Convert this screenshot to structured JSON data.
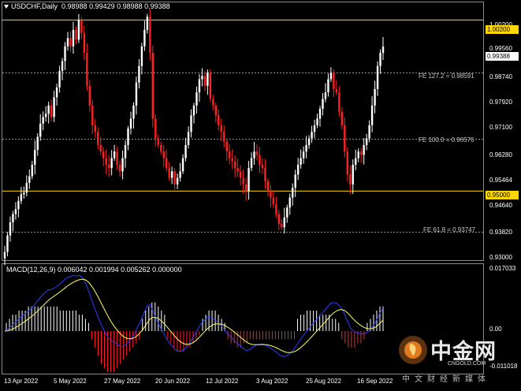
{
  "header": {
    "symbol_timeframe": "USDCHF,Daily",
    "ohlc": "0.98988 0.99429 0.98988 0.99388"
  },
  "indicator": {
    "label": "MACD(12,26,9) 0.006042 0.001994 0.005262 0.000000"
  },
  "price_axis": {
    "ticks": [
      "1.00200",
      "0.99560",
      "0.98740",
      "0.97920",
      "0.97100",
      "0.96280",
      "0.95464",
      "0.94640",
      "0.93820",
      "0.93000"
    ],
    "level_labels": [
      "1.00200",
      "0.95000"
    ],
    "current_price": "0.99388"
  },
  "macd_axis": {
    "ticks": [
      "0.017033",
      "0.00",
      "-0.011018"
    ]
  },
  "time_axis": {
    "labels": [
      "13 Apr 2022",
      "5 May 2022",
      "27 May 2022",
      "20 Jun 2022",
      "12 Jul 2022",
      "3 Aug 2022",
      "25 Aug 2022",
      "16 Sep 2022"
    ]
  },
  "fibonacci": [
    {
      "label": "FE 127.2 = 0.98591",
      "price": 0.98591
    },
    {
      "label": "FE 100.0 = 0.96576",
      "price": 0.96576
    },
    {
      "label": "FE 61.8 = 0.93747",
      "price": 0.93747
    }
  ],
  "levels": [
    1.002,
    0.95
  ],
  "colors": {
    "background": "#000000",
    "bull": "#ffffff",
    "bear": "#ff2020",
    "level": "#ffd700",
    "fib": "#9a9a9a",
    "macd_signal": "#ffff66",
    "macd_line": "#2a3cff"
  },
  "watermark": {
    "brand": "中金网",
    "url": "CNGOLD.COM",
    "tagline": "中文财经新媒体"
  },
  "chart_data": {
    "type": "candlestick",
    "series_interval": "daily",
    "price_range": [
      0.93,
      1.006
    ],
    "macd_range": [
      -0.011018,
      0.017033
    ],
    "close": [
      0.9315,
      0.9365,
      0.9405,
      0.943,
      0.9445,
      0.947,
      0.949,
      0.9495,
      0.9525,
      0.9545,
      0.958,
      0.9625,
      0.9665,
      0.9705,
      0.9725,
      0.9735,
      0.976,
      0.9725,
      0.9785,
      0.9815,
      0.9865,
      0.9895,
      0.994,
      0.9965,
      0.994,
      0.999,
      0.996,
      1.002,
      0.998,
      0.992,
      0.982,
      0.976,
      0.97,
      0.968,
      0.964,
      0.962,
      0.96,
      0.958,
      0.957,
      0.96,
      0.962,
      0.958,
      0.956,
      0.96,
      0.964,
      0.969,
      0.972,
      0.976,
      0.983,
      0.988,
      0.994,
      0.999,
      1.003,
      0.992,
      0.972,
      0.966,
      0.964,
      0.962,
      0.96,
      0.957,
      0.954,
      0.956,
      0.952,
      0.954,
      0.956,
      0.96,
      0.964,
      0.968,
      0.973,
      0.976,
      0.98,
      0.984,
      0.985,
      0.982,
      0.986,
      0.978,
      0.976,
      0.973,
      0.97,
      0.968,
      0.965,
      0.962,
      0.96,
      0.959,
      0.957,
      0.956,
      0.954,
      0.952,
      0.95,
      0.957,
      0.96,
      0.962,
      0.961,
      0.958,
      0.957,
      0.953,
      0.95,
      0.948,
      0.946,
      0.943,
      0.94,
      0.939,
      0.942,
      0.945,
      0.948,
      0.951,
      0.955,
      0.958,
      0.96,
      0.962,
      0.964,
      0.966,
      0.968,
      0.97,
      0.972,
      0.975,
      0.978,
      0.98,
      0.984,
      0.986,
      0.981,
      0.98,
      0.974,
      0.97,
      0.962,
      0.955,
      0.952,
      0.958,
      0.96,
      0.962,
      0.961,
      0.964,
      0.966,
      0.97,
      0.976,
      0.981,
      0.988,
      0.992,
      0.9939
    ],
    "macd_histogram": [
      0.002,
      0.003,
      0.004,
      0.004,
      0.005,
      0.005,
      0.005,
      0.006,
      0.006,
      0.006,
      0.006,
      0.006,
      0.006,
      0.006,
      0.006,
      0.006,
      0.006,
      0.005,
      0.005,
      0.005,
      0.005,
      0.005,
      0.005,
      0.004,
      0.004,
      0.003,
      0.002,
      -0.002,
      -0.004,
      -0.006,
      -0.008,
      -0.009,
      -0.01,
      -0.01,
      -0.01,
      -0.009,
      -0.008,
      -0.007,
      -0.006,
      -0.005,
      -0.004,
      -0.003,
      -0.002,
      0.003,
      0.005,
      0.006,
      0.007,
      0.007,
      0.006,
      0.005,
      0.004,
      -0.002,
      -0.003,
      -0.004,
      -0.005,
      -0.005,
      -0.005,
      -0.004,
      -0.004,
      -0.003,
      -0.002,
      -0.001,
      0.003,
      0.004,
      0.005,
      0.005,
      0.005,
      0.004,
      0.003,
      0.002,
      -0.002,
      -0.003,
      -0.003,
      -0.004,
      -0.004,
      -0.003,
      -0.003,
      -0.002,
      -0.002,
      -0.002,
      -0.002,
      -0.002,
      -0.002,
      -0.002,
      -0.002,
      -0.002,
      -0.002,
      -0.002,
      -0.002,
      -0.002,
      -0.002,
      -0.002,
      0.003,
      0.004,
      0.004,
      0.005,
      0.005,
      0.005,
      0.005,
      0.004,
      0.004,
      0.004,
      0.004,
      0.003,
      0.003,
      0.002,
      -0.002,
      -0.003,
      -0.004,
      -0.004,
      -0.004,
      -0.003,
      -0.003,
      -0.002,
      0.002,
      0.003,
      0.004,
      0.005,
      0.006,
      0.006
    ]
  }
}
